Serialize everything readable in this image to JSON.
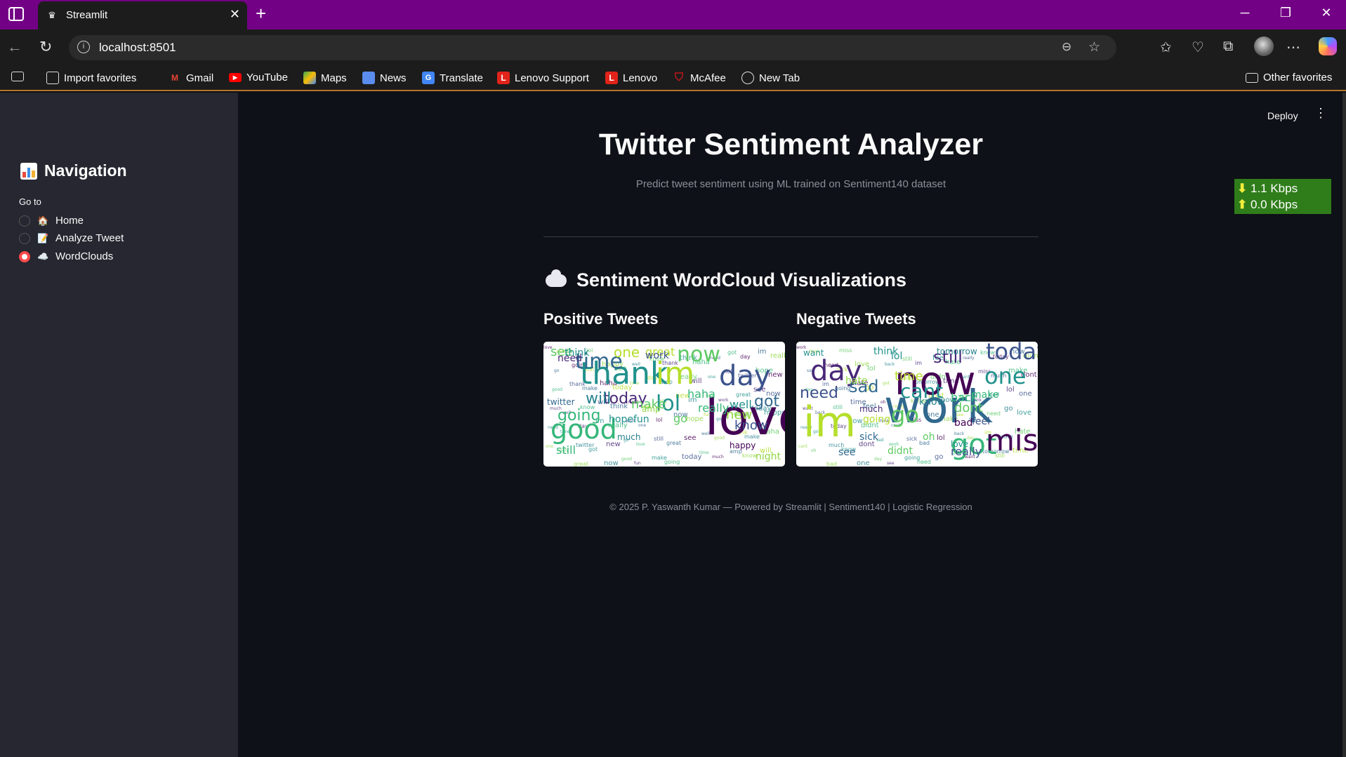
{
  "browser": {
    "tab_title": "Streamlit",
    "url": "localhost:8501",
    "bookmarks": [
      "Import favorites",
      "Gmail",
      "YouTube",
      "Maps",
      "News",
      "Translate",
      "Lenovo Support",
      "Lenovo",
      "McAfee",
      "New Tab"
    ],
    "other_favorites": "Other favorites"
  },
  "sidebar": {
    "title": "Navigation",
    "goto_label": "Go to",
    "options": [
      {
        "label": "Home",
        "emoji": "🏠",
        "selected": false
      },
      {
        "label": "Analyze Tweet",
        "emoji": "📝",
        "selected": false
      },
      {
        "label": "WordClouds",
        "emoji": "☁️",
        "selected": true
      }
    ]
  },
  "header": {
    "deploy_label": "Deploy"
  },
  "main": {
    "title": "Twitter Sentiment Analyzer",
    "subtitle": "Predict tweet sentiment using ML trained on Sentiment140 dataset",
    "section_title": "Sentiment WordCloud Visualizations",
    "positive_title": "Positive Tweets",
    "negative_title": "Negative Tweets",
    "footer": "© 2025 P. Yaswanth Kumar — Powered by Streamlit | Sentiment140 | Logistic Regression"
  },
  "speed_meter": {
    "download": "1.1 Kbps",
    "upload": "0.0 Kbps"
  },
  "wordclouds": {
    "positive_words": [
      "love",
      "thank",
      "im",
      "good",
      "day",
      "now",
      "time",
      "lol",
      "today",
      "one",
      "going",
      "will",
      "go",
      "know",
      "new",
      "well",
      "got",
      "see",
      "need",
      "great",
      "haha",
      "work",
      "make",
      "really",
      "fun",
      "amp",
      "hope",
      "much",
      "twitter",
      "happy",
      "night",
      "still",
      "think"
    ],
    "negative_words": [
      "work",
      "im",
      "now",
      "day",
      "today",
      "one",
      "got",
      "miss",
      "go",
      "cant",
      "need",
      "time",
      "sad",
      "still",
      "dont",
      "back",
      "know",
      "lol",
      "really",
      "bad",
      "hate",
      "think",
      "going",
      "didnt",
      "see",
      "tomorrow",
      "make",
      "want",
      "much",
      "love",
      "oh",
      "sick",
      "feel"
    ]
  }
}
